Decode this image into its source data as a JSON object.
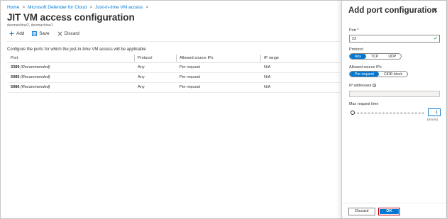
{
  "breadcrumb": [
    "Home",
    "Microsoft Defender for Cloud",
    "Just-in-time VM access"
  ],
  "page": {
    "title": "JIT VM access configuration",
    "more": "···",
    "subtitle": "devmachine2, devmachine1"
  },
  "toolbar": {
    "add": "Add",
    "save": "Save",
    "discard": "Discard"
  },
  "description": "Configure the ports for which the just-in-time VM access will be applicable",
  "table": {
    "columns": [
      "Port",
      "Protocol",
      "Allowed source IPs",
      "IP range"
    ],
    "rows": [
      {
        "port": "3389",
        "note": "(Recommended)",
        "protocol": "Any",
        "source": "Per request",
        "range": "N/A"
      },
      {
        "port": "5985",
        "note": "(Recommended)",
        "protocol": "Any",
        "source": "Per request",
        "range": "N/A"
      },
      {
        "port": "5986",
        "note": "(Recommended)",
        "protocol": "Any",
        "source": "Per request",
        "range": "N/A"
      }
    ]
  },
  "panel": {
    "title": "Add port configuration",
    "close": "✕",
    "port_label": "Port *",
    "port_value": "22",
    "protocol_label": "Protocol",
    "protocol_options": [
      "Any",
      "TCP",
      "UDP"
    ],
    "protocol_selected": "Any",
    "source_label": "Allowed source IPs",
    "source_options": [
      "Per request",
      "CIDR block"
    ],
    "source_selected": "Per request",
    "ip_label": "IP addresses",
    "ip_info": "i",
    "max_label": "Max request time",
    "max_value": "1",
    "hours_label": "(hours)",
    "discard_button": "Discard",
    "ok_button": "OK"
  },
  "colors": {
    "accent": "#0078d4",
    "highlight": "#c50f1f",
    "valid": "#107c10"
  }
}
